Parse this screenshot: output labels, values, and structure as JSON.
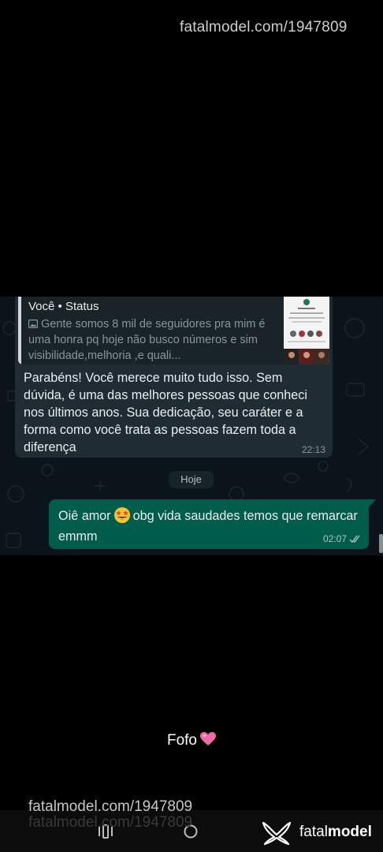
{
  "watermark": {
    "top": "fatalmodel.com/1947809",
    "bottom": "fatalmodel.com/1947809"
  },
  "chat": {
    "incoming": {
      "quote_author": "Você • Status",
      "quote_text": "Gente somos 8 mil de seguidores pra mim é uma honra pq hoje não busco números e sim visibilidade,melhoria ,e quali...",
      "quote_icon": "image-icon",
      "text": "Parabéns! Você merece muito tudo isso. Sem dúvida, é uma das melhores pessoas que conheci nos últimos anos. Sua dedicação, seu caráter e a forma como você trata as pessoas fazem toda a diferença",
      "time": "22:13"
    },
    "day_separator": "Hoje",
    "outgoing": {
      "text_before": "Oiê amor",
      "emoji": "star-struck-emoji",
      "text_after": "obg vida saudades temos que remarcar emmm",
      "time": "02:07",
      "status_icon": "double-check-icon"
    },
    "colors": {
      "background": "#0b141a",
      "incoming_bubble": "#202c33",
      "outgoing_bubble": "#005c4b"
    }
  },
  "caption": {
    "text": "Fofo",
    "emoji": "pink-heart-emoji"
  },
  "navbar": {
    "recents_icon": "recents-icon",
    "home_icon": "home-icon"
  },
  "brand": {
    "logo": "fatalmodel-logo-icon",
    "name_regular": "fatal",
    "name_bold": "model"
  }
}
